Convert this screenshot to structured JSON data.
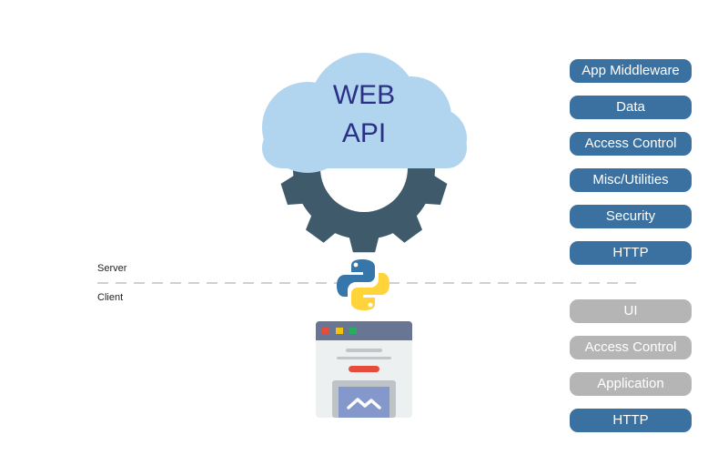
{
  "cloud": {
    "line1": "WEB",
    "line2": "API"
  },
  "labels": {
    "server": "Server",
    "client": "Client"
  },
  "server_layers": [
    "App Middleware",
    "Data",
    "Access Control",
    "Misc/Utilities",
    "Security",
    "HTTP"
  ],
  "client_layers": [
    {
      "label": "UI",
      "active": false
    },
    {
      "label": "Access Control",
      "active": false
    },
    {
      "label": "Application",
      "active": false
    },
    {
      "label": "HTTP",
      "active": true
    }
  ],
  "colors": {
    "active": "#3a71a0",
    "inactive": "#b5b5b5",
    "gear": "#3f5a6b",
    "cloud": "#b1d4ef",
    "cloud_text": "#2b2f86"
  },
  "icons": {
    "gear": "gear-icon",
    "cloud": "cloud-icon",
    "python": "python-logo-icon",
    "browser": "browser-window-icon"
  }
}
